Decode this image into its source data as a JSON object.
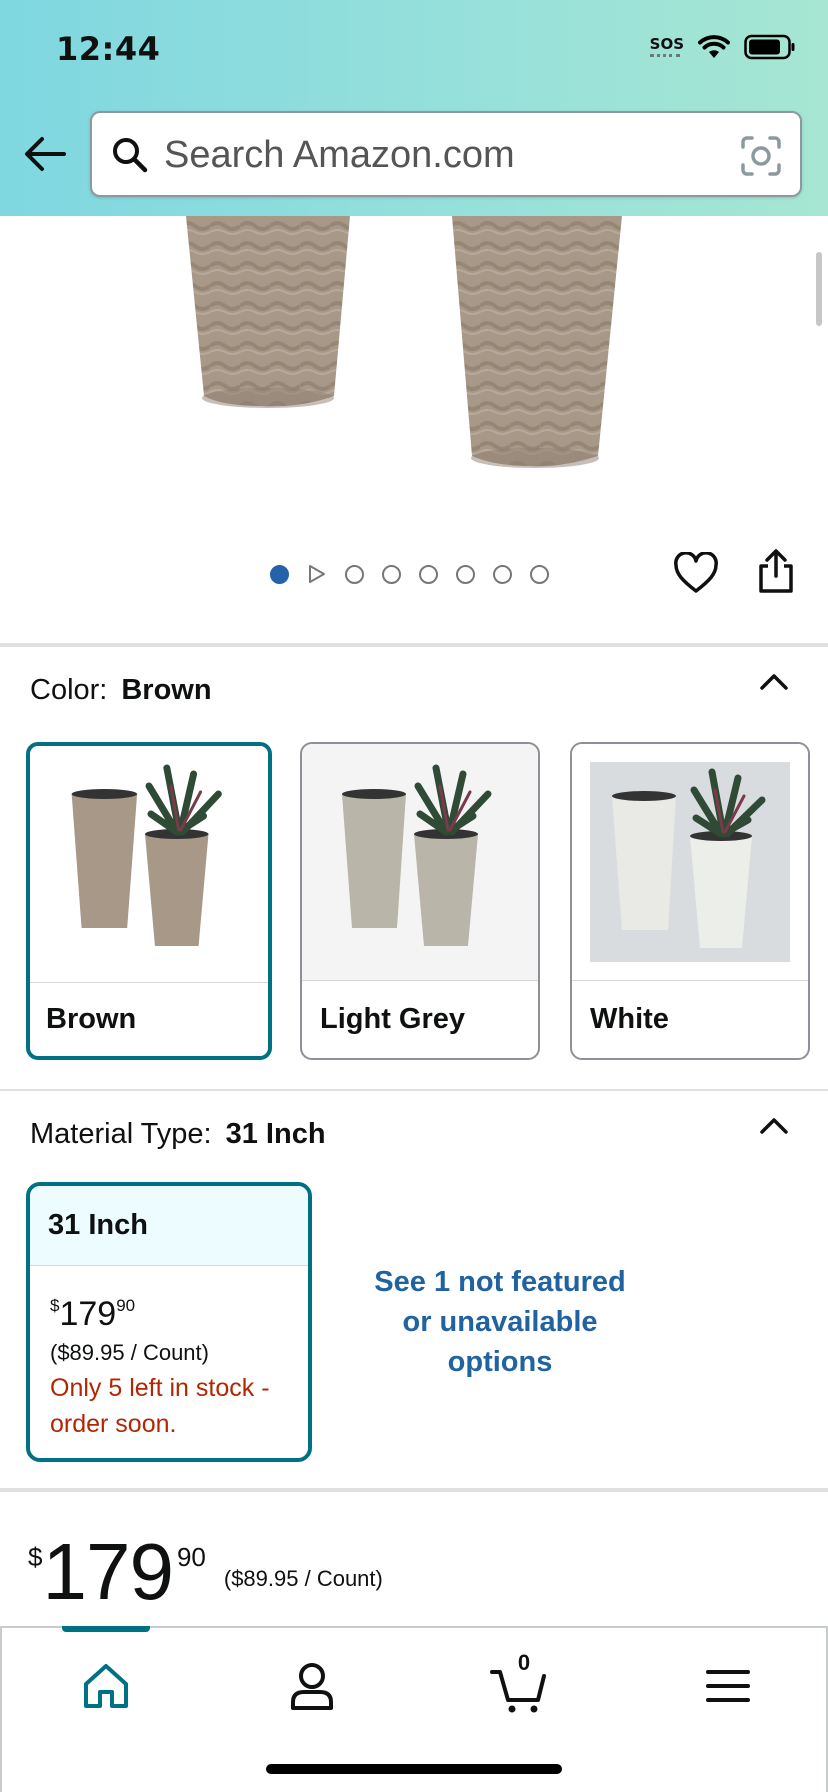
{
  "status_bar": {
    "time": "12:44",
    "sos": "SOS"
  },
  "search": {
    "placeholder": "Search Amazon.com"
  },
  "gallery": {
    "total_images": 8,
    "active_index": 0
  },
  "color_section": {
    "label": "Color:",
    "selected": "Brown",
    "options": [
      {
        "name": "Brown",
        "color": "#a89888"
      },
      {
        "name": "Light Grey",
        "color": "#b9b5a8"
      },
      {
        "name": "White",
        "color": "#e4e6e1"
      }
    ]
  },
  "material_section": {
    "label": "Material Type:",
    "selected": "31 Inch",
    "option": {
      "name": "31 Inch",
      "price_symbol": "$",
      "price_whole": "179",
      "price_fraction": "90",
      "per_count": "($89.95 / Count)",
      "stock": "Only 5 left in stock - order soon."
    },
    "see_more": "See 1 not featured or unavailable options"
  },
  "price": {
    "symbol": "$",
    "whole": "179",
    "fraction": "90",
    "per_count": "($89.95 / Count)"
  },
  "bottom_nav": {
    "items": [
      "home-icon",
      "account-icon",
      "cart-icon",
      "menu-icon"
    ],
    "cart_count": "0",
    "active": "home"
  },
  "colors": {
    "accent": "#007185",
    "link": "#2162a1",
    "alert": "#b12704",
    "header_start": "#7fd7e0",
    "header_end": "#a6e6d2"
  }
}
